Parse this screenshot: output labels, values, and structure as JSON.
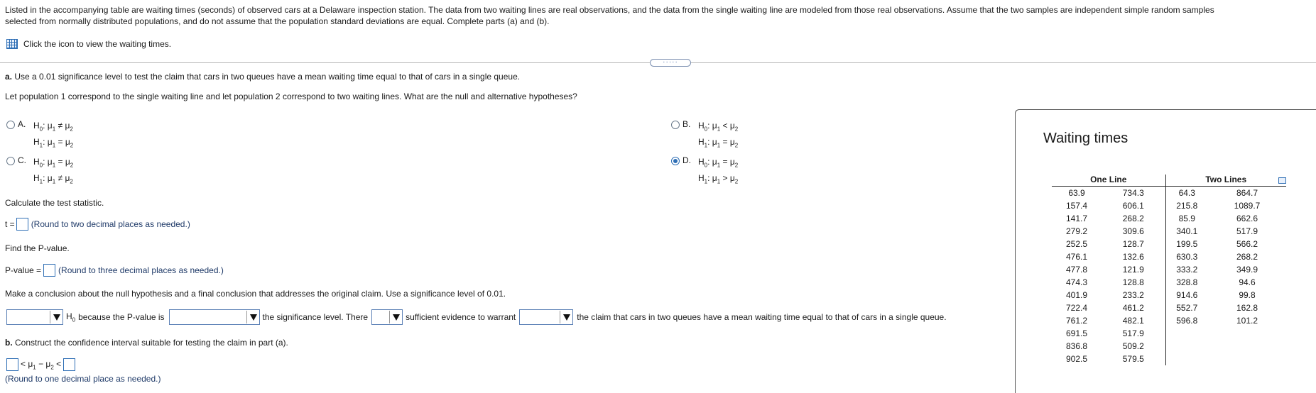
{
  "intro": {
    "line1": "Listed in the accompanying table are waiting times (seconds) of observed cars at a Delaware inspection station. The data from two waiting lines are real observations, and the data from the single waiting line are modeled from those real observations. Assume that the two samples are independent simple random samples",
    "line2": "selected from normally distributed populations, and do not assume that the population standard deviations are equal. Complete parts (a) and (b).",
    "data_link": "Click the icon to view the waiting times."
  },
  "divider_handle": "·····",
  "part_a": {
    "prompt": "a. Use a 0.01 significance level to test the claim that cars in two queues have a mean waiting time equal to that of cars in a single queue.",
    "instruction": "Let population 1 correspond to the single waiting line and let population 2 correspond to two waiting lines. What are the null and alternative hypotheses?",
    "options": [
      {
        "letter": "A.",
        "h0_rel": "≠",
        "h1_rel": "=",
        "selected": false
      },
      {
        "letter": "B.",
        "h0_rel": "<",
        "h1_rel": "=",
        "selected": false
      },
      {
        "letter": "C.",
        "h0_rel": "=",
        "h1_rel": "≠",
        "selected": false
      },
      {
        "letter": "D.",
        "h0_rel": "=",
        "h1_rel": ">",
        "selected": true
      }
    ],
    "h0_label": "H",
    "h0_sub": "0",
    "h1_sub": "1",
    "mu": "μ",
    "mu1_sub": "1",
    "mu2_sub": "2",
    "test_stat_prompt": "Calculate the test statistic.",
    "t_label": "t =",
    "t_note": "(Round to two decimal places as needed.)",
    "pvalue_prompt": "Find the P-value.",
    "pvalue_label": "P-value =",
    "pvalue_note": "(Round to three decimal places as needed.)",
    "conclusion_prompt": "Make a conclusion about the null hypothesis and a final conclusion that addresses the original claim. Use a significance level of 0.01.",
    "concl_h0": "because the P-value is",
    "concl_sig": "the significance level. There",
    "concl_evidence": "sufficient evidence to warrant",
    "concl_claim": "the claim that cars in two queues have a mean waiting time equal to that of cars in a single queue."
  },
  "part_b": {
    "prompt": "b. Construct the confidence interval suitable for testing the claim in part (a).",
    "lt": "<",
    "minus": "−",
    "note": "(Round to one decimal place as needed.)"
  },
  "panel": {
    "title": "Waiting times",
    "headers": [
      "One Line",
      "Two Lines"
    ],
    "one_line_rows": [
      [
        "63.9",
        "734.3"
      ],
      [
        "157.4",
        "606.1"
      ],
      [
        "141.7",
        "268.2"
      ],
      [
        "279.2",
        "309.6"
      ],
      [
        "252.5",
        "128.7"
      ],
      [
        "476.1",
        "132.6"
      ],
      [
        "477.8",
        "121.9"
      ],
      [
        "474.3",
        "128.8"
      ],
      [
        "401.9",
        "233.2"
      ],
      [
        "722.4",
        "461.2"
      ],
      [
        "761.2",
        "482.1"
      ],
      [
        "691.5",
        "517.9"
      ],
      [
        "836.8",
        "509.2"
      ],
      [
        "902.5",
        "579.5"
      ]
    ],
    "two_lines_rows": [
      [
        "64.3",
        "864.7"
      ],
      [
        "215.8",
        "1089.7"
      ],
      [
        "85.9",
        "662.6"
      ],
      [
        "340.1",
        "517.9"
      ],
      [
        "199.5",
        "566.2"
      ],
      [
        "630.3",
        "268.2"
      ],
      [
        "333.2",
        "349.9"
      ],
      [
        "328.8",
        "94.6"
      ],
      [
        "914.6",
        "99.8"
      ],
      [
        "552.7",
        "162.8"
      ],
      [
        "596.8",
        "101.2"
      ],
      [
        "",
        ""
      ],
      [
        "",
        ""
      ],
      [
        "",
        ""
      ]
    ]
  }
}
